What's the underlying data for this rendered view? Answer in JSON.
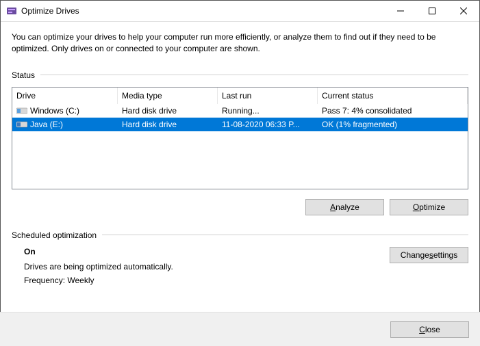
{
  "titlebar": {
    "title": "Optimize Drives"
  },
  "intro": "You can optimize your drives to help your computer run more efficiently, or analyze them to find out if they need to be optimized. Only drives on or connected to your computer are shown.",
  "status_label": "Status",
  "columns": {
    "drive": "Drive",
    "media": "Media type",
    "last": "Last run",
    "status": "Current status"
  },
  "rows": [
    {
      "drive": "Windows (C:)",
      "media": "Hard disk drive",
      "last": "Running...",
      "status": "Pass 7: 4% consolidated",
      "selected": false
    },
    {
      "drive": "Java (E:)",
      "media": "Hard disk drive",
      "last": "11-08-2020 06:33 P...",
      "status": "OK (1% fragmented)",
      "selected": true
    }
  ],
  "buttons": {
    "analyze_pre": "",
    "analyze_ul": "A",
    "analyze_post": "nalyze",
    "optimize_pre": "",
    "optimize_ul": "O",
    "optimize_post": "ptimize",
    "changesettings_pre": "Change ",
    "changesettings_ul": "s",
    "changesettings_post": "ettings",
    "close_pre": "",
    "close_ul": "C",
    "close_post": "lose"
  },
  "sched": {
    "label": "Scheduled optimization",
    "on": "On",
    "desc": "Drives are being optimized automatically.",
    "freq": "Frequency: Weekly"
  }
}
